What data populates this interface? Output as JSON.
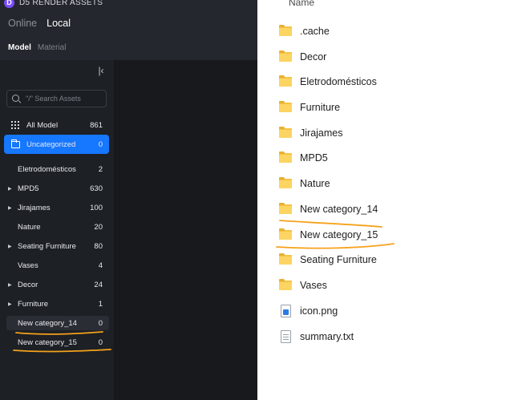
{
  "app": {
    "brand": "D5 RENDER ASSETS",
    "brand_logo": "D",
    "tabs": [
      "Online",
      "Local"
    ],
    "active_tab": "Local",
    "sub_tabs": [
      "Model",
      "Material"
    ],
    "active_sub_tab": "Model",
    "search_placeholder": "\"/\" Search Assets",
    "all_model": {
      "label": "All Model",
      "count": "861"
    },
    "uncategorized": {
      "label": "Uncategorized",
      "count": "0"
    },
    "categories": [
      {
        "label": "Eletrodomésticos",
        "count": "2",
        "expandable": false
      },
      {
        "label": "MPD5",
        "count": "630",
        "expandable": true
      },
      {
        "label": "Jirajames",
        "count": "100",
        "expandable": true
      },
      {
        "label": "Nature",
        "count": "20",
        "expandable": false
      },
      {
        "label": "Seating Furniture",
        "count": "80",
        "expandable": true
      },
      {
        "label": "Vases",
        "count": "4",
        "expandable": false
      },
      {
        "label": "Decor",
        "count": "24",
        "expandable": true
      },
      {
        "label": "Furniture",
        "count": "1",
        "expandable": true
      },
      {
        "label": "New category_14",
        "count": "0",
        "expandable": false
      },
      {
        "label": "New category_15",
        "count": "0",
        "expandable": false
      }
    ],
    "colors": {
      "accent": "#1677ff",
      "annotation": "#f5a21b"
    }
  },
  "explorer": {
    "column_header": "Name",
    "items": [
      {
        "name": ".cache",
        "type": "folder"
      },
      {
        "name": "Decor",
        "type": "folder"
      },
      {
        "name": "Eletrodomésticos",
        "type": "folder"
      },
      {
        "name": "Furniture",
        "type": "folder"
      },
      {
        "name": "Jirajames",
        "type": "folder"
      },
      {
        "name": "MPD5",
        "type": "folder"
      },
      {
        "name": "Nature",
        "type": "folder"
      },
      {
        "name": "New category_14",
        "type": "folder"
      },
      {
        "name": "New category_15",
        "type": "folder"
      },
      {
        "name": "Seating Furniture",
        "type": "folder"
      },
      {
        "name": "Vases",
        "type": "folder"
      },
      {
        "name": "icon.png",
        "type": "png"
      },
      {
        "name": "summary.txt",
        "type": "txt"
      }
    ]
  }
}
